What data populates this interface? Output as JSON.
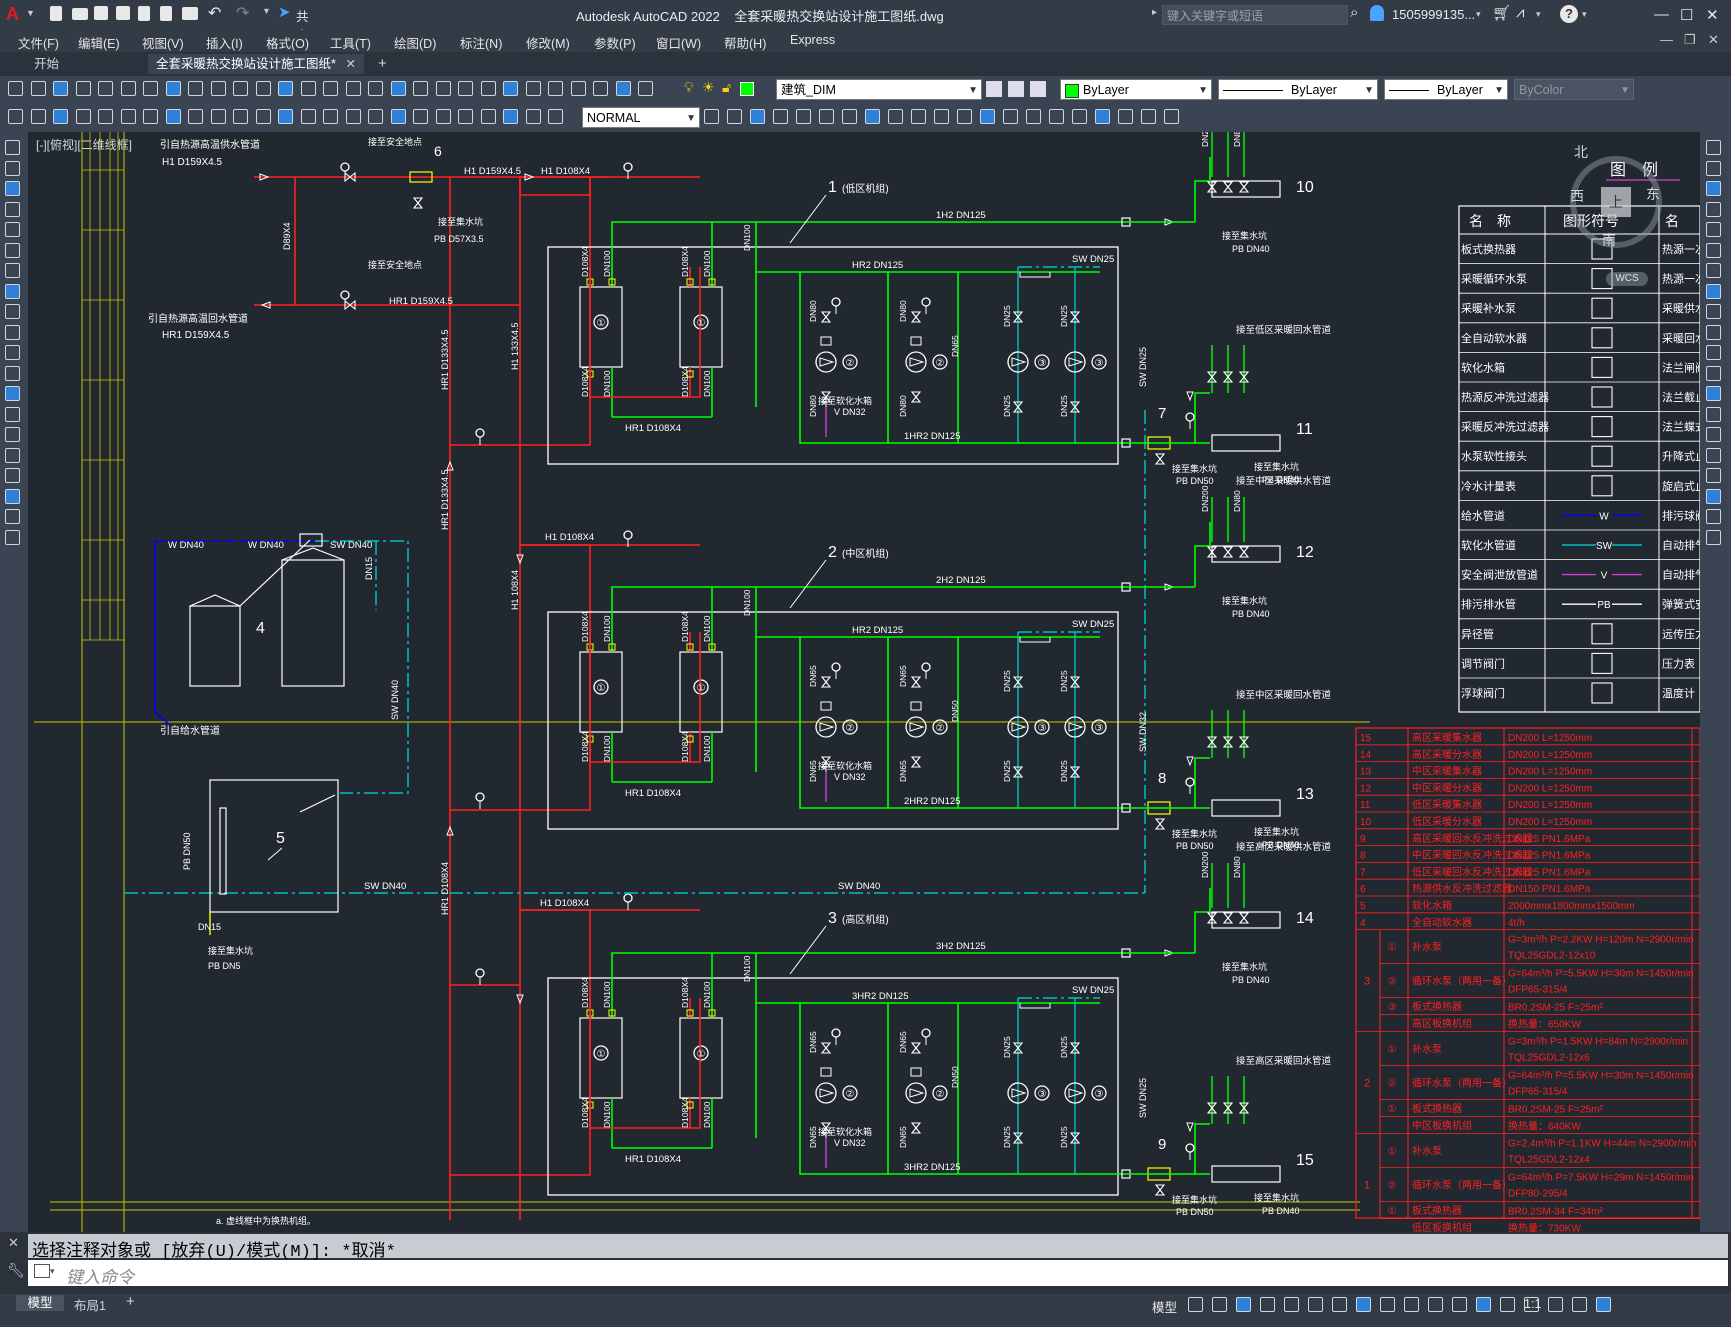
{
  "app": {
    "title": "Autodesk AutoCAD 2022",
    "file_name": "全套采暖热交换站设计施工图纸.dwg",
    "share_label": "共享",
    "search_placeholder": "键入关键字或短语",
    "user_id": "1505999135...",
    "help_label": "?"
  },
  "menu": [
    "文件(F)",
    "编辑(E)",
    "视图(V)",
    "插入(I)",
    "格式(O)",
    "工具(T)",
    "绘图(D)",
    "标注(N)",
    "修改(M)",
    "参数(P)",
    "窗口(W)",
    "帮助(H)",
    "Express"
  ],
  "tabs": {
    "start": "开始",
    "drawing": "全套采暖热交换站设计施工图纸*",
    "add": "+"
  },
  "layer": {
    "current": "建筑_DIM"
  },
  "properties": {
    "color": "ByLayer",
    "linetype": "ByLayer",
    "lineweight": "ByLayer",
    "plotstyle": "ByColor"
  },
  "dimstyle": "NORMAL",
  "viewport_label": "[-][俯视][二维线框]",
  "viewcube": {
    "north": "北",
    "south": "南",
    "east": "东",
    "west": "西",
    "top": "上",
    "wcs": "WCS"
  },
  "command": {
    "history": "选择注释对象或 [放弃(U)/模式(M)]: *取消*",
    "placeholder": "键入命令"
  },
  "layout_tabs": [
    "模型",
    "布局1"
  ],
  "status": {
    "model": "模型",
    "scale": "1:1"
  },
  "drawing": {
    "unit_labels": [
      {
        "num": "1",
        "name": "(低区机组)"
      },
      {
        "num": "2",
        "name": "(中区机组)"
      },
      {
        "num": "3",
        "name": "(高区机组)"
      }
    ],
    "supply_labels": [
      "接至低区采暖供水管道",
      "接至中区采暖供水管道",
      "接至高区采暖供水管道"
    ],
    "return_labels": [
      "接至低区采暖回水管道",
      "接至中区采暖回水管道",
      "接至高区采暖回水管道"
    ],
    "pipe_labels": {
      "src_supply": "引自热源高温供水管道",
      "src_supply_size": "H1 D159X4.5",
      "src_return": "引自热源高温回水管道",
      "src_return_size": "HR1 D159X4.5",
      "safety": "接至安全地点",
      "drain": "接至集水坑",
      "drain_size": "PB D57X3.5",
      "h1": "H1 D108X4",
      "hr1": "HR1 D159X4.5",
      "d89": "D89X4",
      "h1_159": "H1 D159X4.5",
      "hr1_133": "HR1 D133X4.5",
      "h1_133": "H1 133X4.5",
      "h1_108": "H1 108X4",
      "hr1_108": "HR1 D108X4",
      "w40": "W DN40",
      "sw40": "SW DN40",
      "sw25": "SW DN25",
      "sw32": "SW DN32",
      "softener": "接至软化水箱",
      "v32": "V DN32",
      "src_water": "引自给水管道",
      "pb50": "PB DN50",
      "dn15": "DN15",
      "pb_dn5": "PB DN5"
    },
    "unit1": {
      "h2": "1H2 DN125",
      "hr2": "HR2 DN125",
      "hr2b": "1HR2 DN125",
      "hr1": "HR1 D108X4"
    },
    "unit2": {
      "h2": "2H2 DN125",
      "hr2": "HR2 DN125",
      "hr2b": "2HR2 DN125",
      "hr1": "HR1 D108X4"
    },
    "unit3": {
      "h2": "3H2 DN125",
      "hr2": "3HR2 DN125",
      "hr2b": "3HR2 DN125",
      "hr1": "HR1 D108X4"
    },
    "numbers": [
      "4",
      "5",
      "6",
      "7",
      "8",
      "9",
      "10",
      "11",
      "12",
      "13",
      "14",
      "15"
    ],
    "drain_to": "接至集水坑",
    "footer_note": "a. 虚线框中为换热机组。"
  },
  "legend": {
    "header": "图　例",
    "col_name": "名　称",
    "col_symbol": "图形符号",
    "col_name2": "名",
    "rows": [
      {
        "name": "板式换热器",
        "right": "热源一次供"
      },
      {
        "name": "采暖循环水泵",
        "right": "热源一次回"
      },
      {
        "name": "采暖补水泵",
        "right": "采暖供水管"
      },
      {
        "name": "全自动软水器",
        "right": "采暖回水管"
      },
      {
        "name": "软化水箱",
        "right": "法兰闸阀"
      },
      {
        "name": "热源反冲洗过滤器",
        "right": "法兰截止阀"
      },
      {
        "name": "采暖反冲洗过滤器",
        "right": "法兰蝶式阀"
      },
      {
        "name": "水泵软性接头",
        "right": "升降式止回"
      },
      {
        "name": "冷水计量表",
        "right": "旋启式止回"
      },
      {
        "name": "给水管道",
        "sym": "W",
        "right": "排污球阀"
      },
      {
        "name": "软化水管道",
        "sym": "SW",
        "right": "自动排气阀"
      },
      {
        "name": "安全阀泄放管道",
        "sym": "V",
        "right": "自动排气阀"
      },
      {
        "name": "排污排水管",
        "sym": "PB",
        "right": "弹簧式安全"
      },
      {
        "name": "异径管",
        "right": "远传压力表"
      },
      {
        "name": "调节阀门",
        "right": "压力表"
      },
      {
        "name": "浮球阀门",
        "right": "温度计"
      }
    ]
  },
  "equipment": {
    "rows": [
      {
        "no": "15",
        "name": "高区采暖集水器",
        "spec": "DN200  L=1250mm"
      },
      {
        "no": "14",
        "name": "高区采暖分水器",
        "spec": "DN200  L=1250mm"
      },
      {
        "no": "13",
        "name": "中区采暖集水器",
        "spec": "DN200  L=1250mm"
      },
      {
        "no": "12",
        "name": "中区采暖分水器",
        "spec": "DN200  L=1250mm"
      },
      {
        "no": "11",
        "name": "低区采暖集水器",
        "spec": "DN200  L=1250mm"
      },
      {
        "no": "10",
        "name": "低区采暖分水器",
        "spec": "DN200  L=1250mm"
      },
      {
        "no": "9",
        "name": "高区采暖回水反冲洗过滤器",
        "spec": "DN125  PN1.6MPa"
      },
      {
        "no": "8",
        "name": "中区采暖回水反冲洗过滤器",
        "spec": "DN125  PN1.6MPa"
      },
      {
        "no": "7",
        "name": "低区采暖回水反冲洗过滤器",
        "spec": "DN125  PN1.6MPa"
      },
      {
        "no": "6",
        "name": "热源供水反冲洗过滤器",
        "spec": "DN150  PN1.6MPa"
      },
      {
        "no": "5",
        "name": "软化水箱",
        "spec": "2000mmx1800mmx1500mm"
      },
      {
        "no": "4",
        "name": "全自动软水器",
        "spec": "4t/h"
      }
    ],
    "unit3": [
      {
        "mark": "①",
        "name": "补水泵",
        "spec": "G=3m³/h P=2.2KW H=120m N=2900r/min",
        "spec2": "TQL25GDL2-12x10"
      },
      {
        "mark": "②",
        "name": "循环水泵（两用一备）",
        "spec": "G=64m³/h P=5.5KW H=30m N=1450r/min",
        "spec2": "DFP65-315/4"
      },
      {
        "mark": "③",
        "name": "板式换热器",
        "spec": "BR0.2SM-25  F=25m²"
      },
      {
        "mark": "",
        "name": "高区板换机组",
        "spec": "换热量：650KW"
      }
    ],
    "unit2": [
      {
        "mark": "①",
        "name": "补水泵",
        "spec": "G=3m³/h P=1.5KW H=84m N=2900r/min",
        "spec2": "TQL25GDL2-12x6"
      },
      {
        "mark": "②",
        "name": "循环水泵（两用一备）",
        "spec": "G=64m³/h P=5.5KW H=30m N=1450r/min",
        "spec2": "DFP65-315/4"
      },
      {
        "mark": "①",
        "name": "板式换热器",
        "spec": "BR0.2SM-25  F=25m²"
      },
      {
        "mark": "",
        "name": "中区板换机组",
        "spec": "换热量：640KW"
      }
    ],
    "unit1": [
      {
        "mark": "①",
        "name": "补水泵",
        "spec": "G=2.4m³/h P=1.1KW H=44m N=2900r/min",
        "spec2": "TQL25GDL2-12x4"
      },
      {
        "mark": "②",
        "name": "循环水泵（两用一备）",
        "spec": "G=64m³/h P=7.5KW H=29m N=1450r/min",
        "spec2": "DFP80-295/4"
      },
      {
        "mark": "①",
        "name": "板式换热器",
        "spec": "BR0.2SM-34  F=34m²"
      },
      {
        "mark": "",
        "name": "低区板换机组",
        "spec": "换热量：730KW"
      }
    ],
    "unit_nums": [
      "3",
      "2",
      "1"
    ]
  },
  "colors": {
    "bg": "#212830",
    "supply": "#ff2020",
    "return": "#00ff00",
    "water": "#0000ff",
    "softwater": "#00c0c0",
    "white": "#ffffff",
    "yellow": "#ffff00"
  }
}
